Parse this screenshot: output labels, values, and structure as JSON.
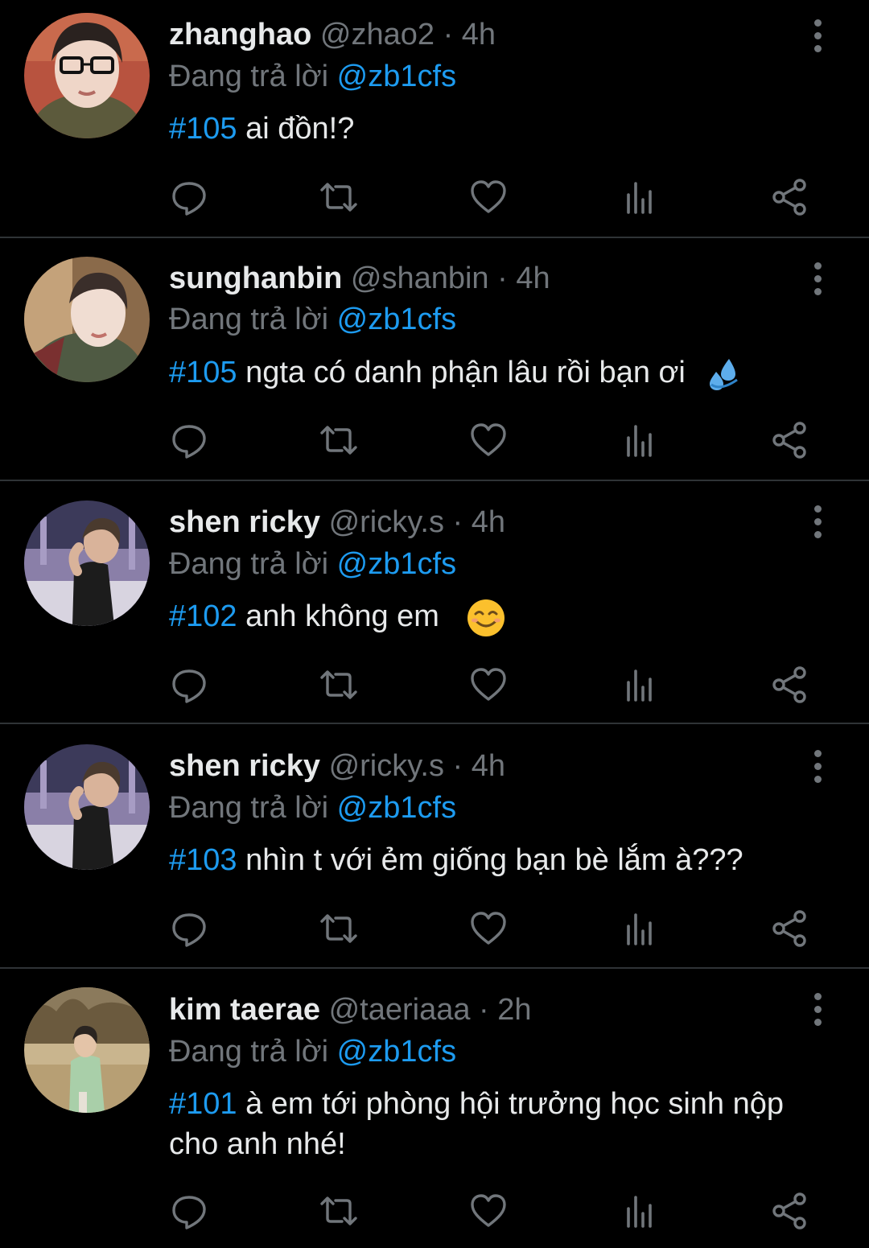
{
  "theme": {
    "background": "#000000",
    "text": "#e7e9ea",
    "muted": "#71767b",
    "accent": "#1d9bf0",
    "divider": "#2f3336"
  },
  "tweets": [
    {
      "name": "zhanghao",
      "handle": "@zhao2",
      "separator": "·",
      "time": "4h",
      "reply_prefix": "Đang trả lời",
      "reply_to": "@zb1cfs",
      "hashtag": "#105",
      "text": "ai đồn!?",
      "emoji": ""
    },
    {
      "name": "sunghanbin",
      "handle": "@shanbin",
      "separator": "·",
      "time": "4h",
      "reply_prefix": "Đang trả lời",
      "reply_to": "@zb1cfs",
      "hashtag": "#105",
      "text": "ngta có danh phận lâu rồi bạn ơi",
      "emoji": "sweat-droplets-emoji"
    },
    {
      "name": "shen ricky",
      "handle": "@ricky.s",
      "separator": "·",
      "time": "4h",
      "reply_prefix": "Đang trả lời",
      "reply_to": "@zb1cfs",
      "hashtag": "#102",
      "text": "anh không em",
      "emoji": "smiling-face-emoji"
    },
    {
      "name": "shen ricky",
      "handle": "@ricky.s",
      "separator": "·",
      "time": "4h",
      "reply_prefix": "Đang trả lời",
      "reply_to": "@zb1cfs",
      "hashtag": "#103",
      "text": "nhìn t với ẻm giống bạn bè lắm à???",
      "emoji": ""
    },
    {
      "name": "kim taerae",
      "handle": "@taeriaaa",
      "separator": "·",
      "time": "2h",
      "reply_prefix": "Đang trả lời",
      "reply_to": "@zb1cfs",
      "hashtag": "#101",
      "text": "à em tới phòng hội trưởng học sinh nộp cho anh nhé!",
      "emoji": ""
    }
  ],
  "action_icons": [
    "reply-icon",
    "retweet-icon",
    "like-icon",
    "views-icon",
    "share-icon"
  ]
}
